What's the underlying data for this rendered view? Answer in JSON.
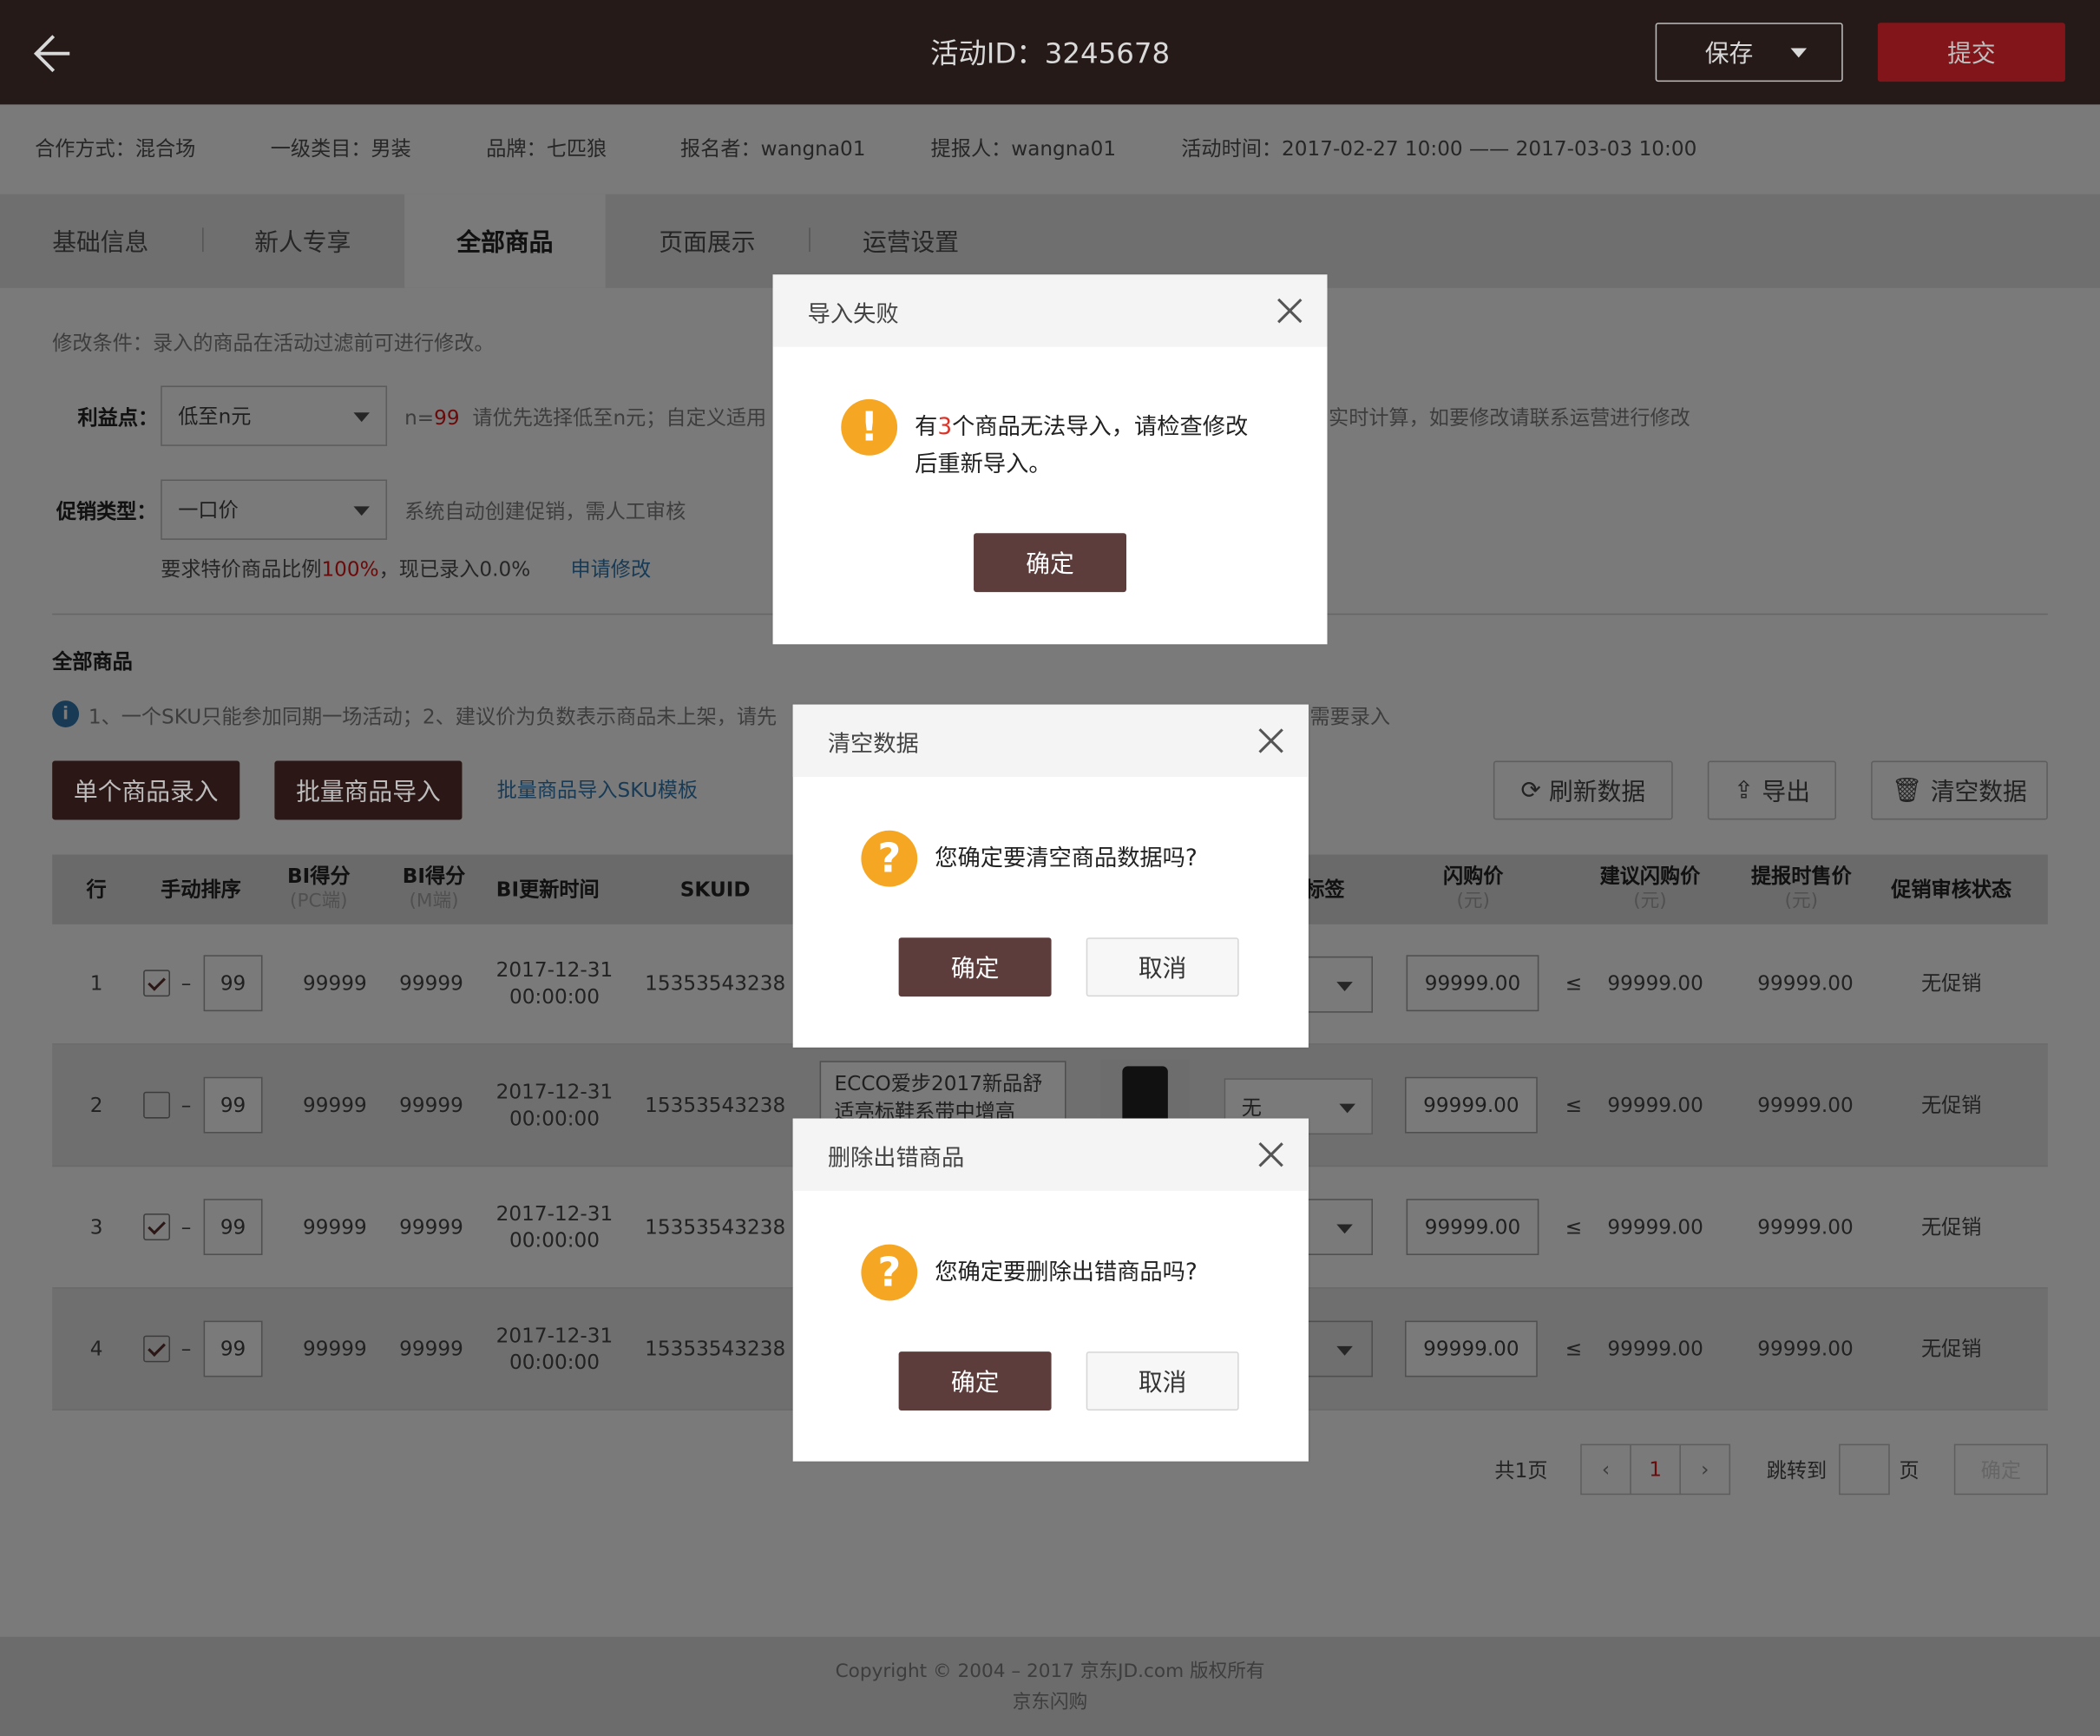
{
  "header": {
    "title": "活动ID：3245678",
    "save_label": "保存",
    "submit_label": "提交"
  },
  "info": [
    "合作方式：混合场",
    "一级类目：男装",
    "品牌：七匹狼",
    "报名者：wangna01",
    "提报人：wangna01",
    "活动时间：2017-02-27 10:00 —— 2017-03-03 10:00"
  ],
  "tabs": [
    "基础信息",
    "新人专享",
    "全部商品",
    "页面展示",
    "运营设置"
  ],
  "form": {
    "condition": "修改条件：录入的商品在活动过滤前可进行修改。",
    "benefit_label": "利益点：",
    "benefit_value": "低至n元",
    "benefit_n_prefix": "n=",
    "benefit_n": "99",
    "benefit_hint": "请优先选择低至n元；自定义适用",
    "benefit_hint_tail": "实时计算，如要修改请联系运营进行修改",
    "promo_label": "促销类型：",
    "promo_value": "一口价",
    "promo_hint": "系统自动创建促销，需人工审核",
    "ratio_prefix": "要求特价商品比例",
    "ratio_value": "100%",
    "ratio_suffix": "，现已录入0.0%",
    "apply_link": "申请修改"
  },
  "section": {
    "title": "全部商品",
    "notice": "1、一个SKU只能参加同期一场活动；2、建议价为负数表示商品未上架，请先",
    "notice_tail": "需要录入"
  },
  "toolbar": {
    "single": "单个商品录入",
    "batch": "批量商品导入",
    "template": "批量商品导入SKU模板",
    "refresh": "刷新数据",
    "export": "导出",
    "clear": "清空数据"
  },
  "table": {
    "headers": {
      "row": "行",
      "sort": "手动排序",
      "bi_pc": "BI得分",
      "bi_pc_sub": "(PC端)",
      "bi_m": "BI得分",
      "bi_m_sub": "(M端)",
      "bi_time": "BI更新时间",
      "skuid": "SKUID",
      "tag": "标签",
      "flash": "闪购价",
      "flash_sub": "(元)",
      "suggest": "建议闪购价",
      "suggest_sub": "(元)",
      "report": "提报时售价",
      "report_sub": "(元)",
      "audit": "促销审核状态"
    },
    "rows": [
      {
        "n": "1",
        "checked": true,
        "sort": "99",
        "pc": "99999",
        "m": "99999",
        "time": "2017-12-31 00:00:00",
        "sku": "15353543238",
        "flash": "99999.00",
        "le": "≤",
        "suggest": "99999.00",
        "report": "99999.00",
        "audit": "无促销"
      },
      {
        "n": "2",
        "checked": false,
        "sort": "99",
        "pc": "99999",
        "m": "99999",
        "time": "2017-12-31 00:00:00",
        "sku": "15353543238",
        "name": "ECCO爱步2017新品舒适亮标鞋系带中增高",
        "tag": "无",
        "flash": "99999.00",
        "le": "≤",
        "suggest": "99999.00",
        "report": "99999.00",
        "audit": "无促销"
      },
      {
        "n": "3",
        "checked": true,
        "sort": "99",
        "pc": "99999",
        "m": "99999",
        "time": "2017-12-31 00:00:00",
        "sku": "15353543238",
        "flash": "99999.00",
        "le": "≤",
        "suggest": "99999.00",
        "report": "99999.00",
        "audit": "无促销"
      },
      {
        "n": "4",
        "checked": true,
        "sort": "99",
        "pc": "99999",
        "m": "99999",
        "time": "2017-12-31 00:00:00",
        "sku": "15353543238",
        "flash": "99999.00",
        "le": "≤",
        "suggest": "99999.00",
        "report": "99999.00",
        "audit": "无促销"
      }
    ]
  },
  "pagination": {
    "total": "共1页",
    "current": "1",
    "jump": "跳转到",
    "page": "页",
    "go": "确定"
  },
  "footer": {
    "copyright": "Copyright © 2004 – 2017  京东JD.com 版权所有",
    "brand": "京东闪购"
  },
  "dialogs": {
    "import_fail": {
      "title": "导入失败",
      "msg_pre": "有",
      "count": "3",
      "msg_post": "个商品无法导入，请检查修改后重新导入。",
      "ok": "确定"
    },
    "clear": {
      "title": "清空数据",
      "msg": "您确定要清空商品数据吗?",
      "ok": "确定",
      "cancel": "取消"
    },
    "delete": {
      "title": "删除出错商品",
      "msg": "您确定要删除出错商品吗?",
      "ok": "确定",
      "cancel": "取消"
    }
  },
  "icons": [
    "back-arrow-icon",
    "dropdown-arrow-icon",
    "info-icon",
    "refresh-icon",
    "export-icon",
    "trash-icon",
    "close-icon",
    "warning-icon",
    "question-icon",
    "chevron-left-icon",
    "chevron-right-icon"
  ],
  "colors": {
    "header_bg": "#261a18",
    "submit": "#821519",
    "primary_btn": "#5d3c3c",
    "warning": "#f5a623",
    "link": "#1a78c8",
    "alert_red": "#d9362b"
  }
}
